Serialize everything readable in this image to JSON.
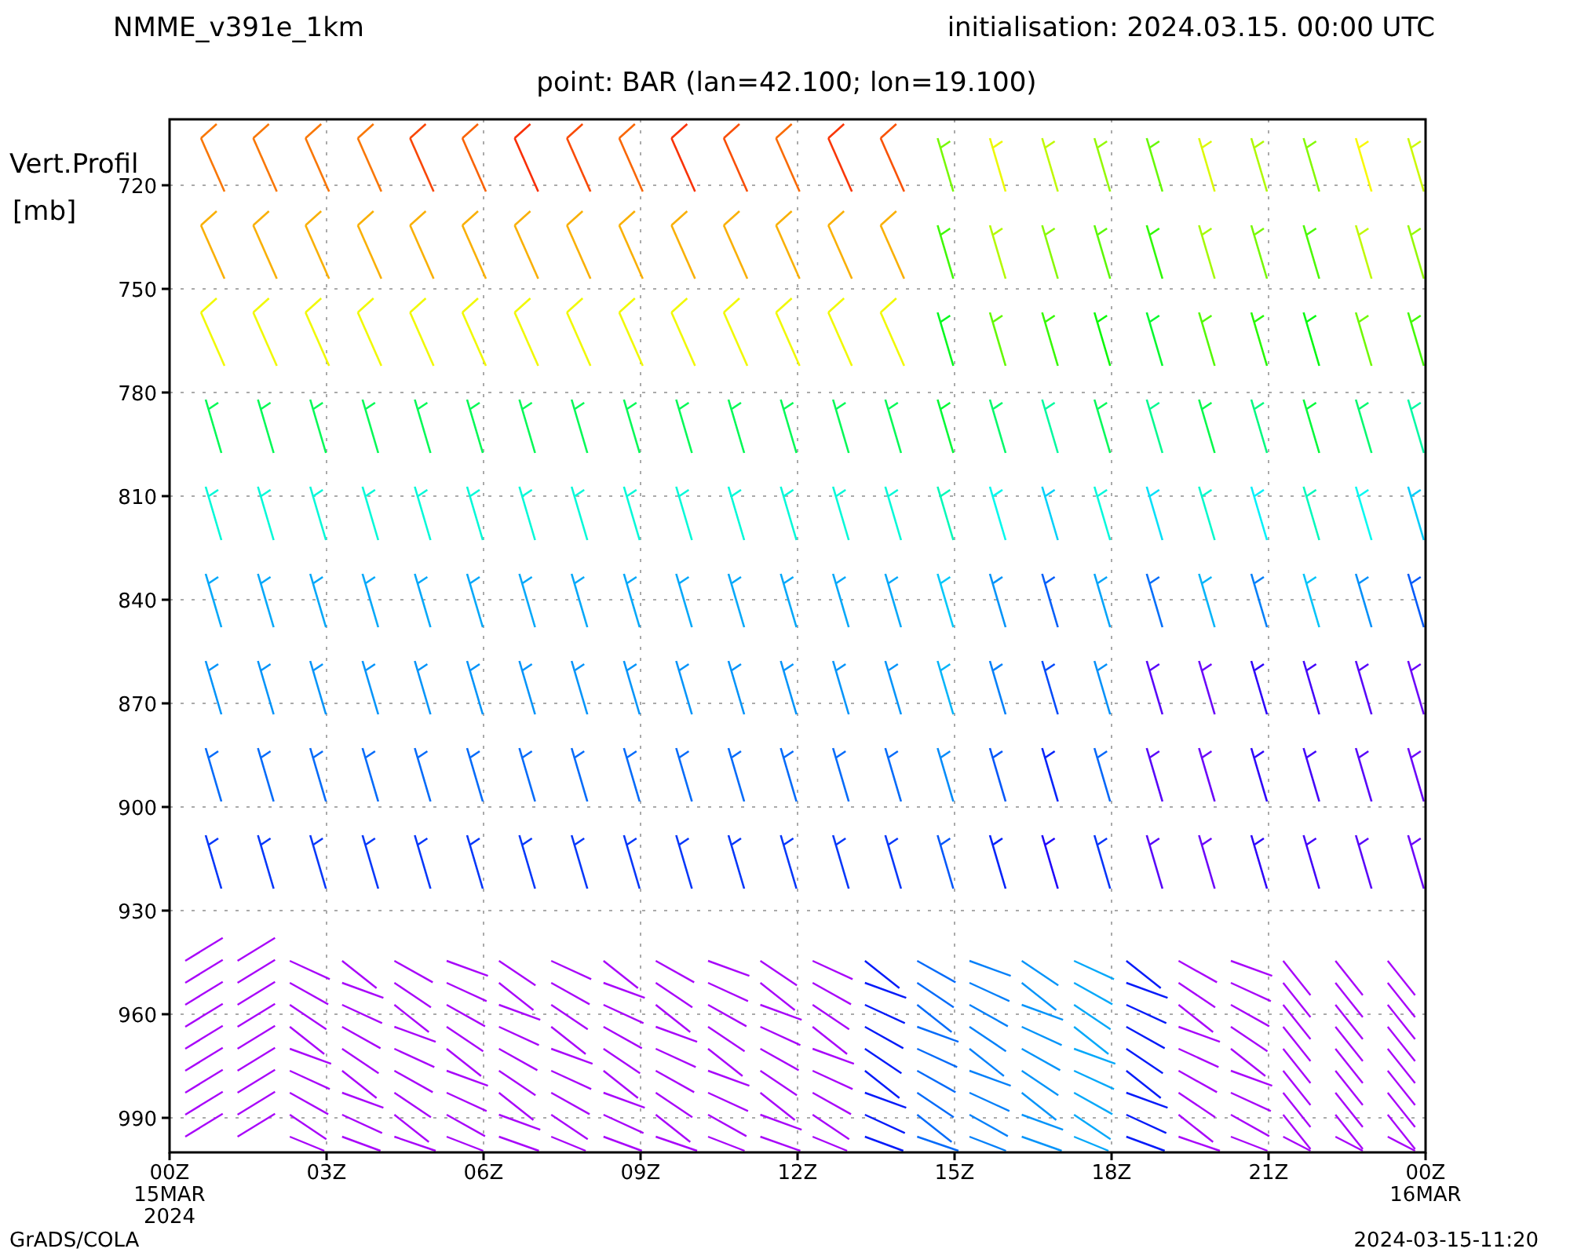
{
  "header": {
    "model": "NMME_v391e_1km",
    "initialisation": "initialisation: 2024.03.15. 00:00 UTC"
  },
  "subtitle": "point: BAR (lan=42.100; lon=19.100)",
  "chart": {
    "ylabel_lines": [
      "Vert.Profil",
      "[mb]"
    ],
    "yticks": [
      "720",
      "750",
      "780",
      "810",
      "840",
      "870",
      "900",
      "930",
      "960",
      "990"
    ],
    "xticks": [
      {
        "label": "00Z",
        "sub": [
          "15MAR",
          "2024"
        ]
      },
      {
        "label": "03Z"
      },
      {
        "label": "06Z"
      },
      {
        "label": "09Z"
      },
      {
        "label": "12Z"
      },
      {
        "label": "15Z"
      },
      {
        "label": "18Z"
      },
      {
        "label": "21Z"
      },
      {
        "label": "00Z",
        "sub": [
          "16MAR"
        ]
      }
    ]
  },
  "footer": {
    "left": "GrADS/COLA",
    "right": "2024-03-15-11:20"
  }
}
